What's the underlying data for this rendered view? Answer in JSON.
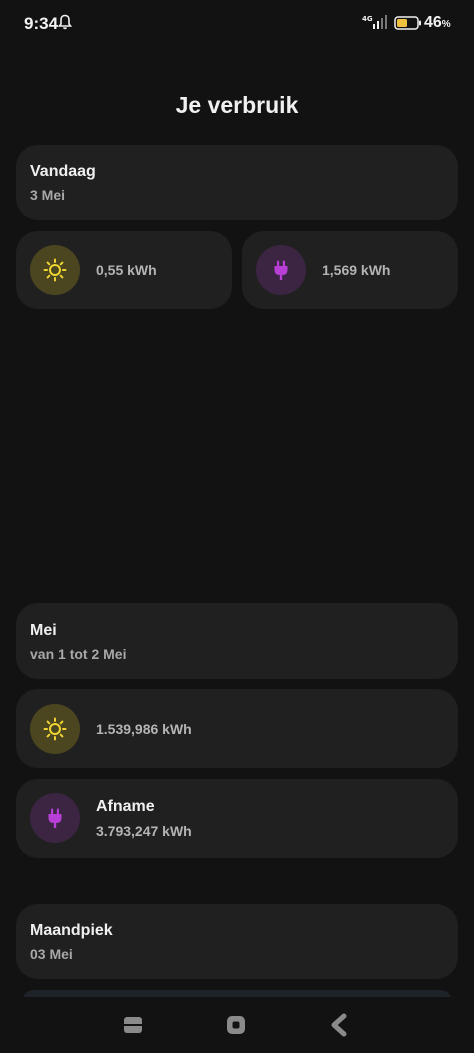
{
  "status": {
    "time": "9:34",
    "network": "4G",
    "battery": "46",
    "battery_unit": "%"
  },
  "page": {
    "title": "Je verbruik"
  },
  "today": {
    "title": "Vandaag",
    "date": "3 Mei",
    "solar_value": "0,55 kWh",
    "grid_value": "1,569 kWh"
  },
  "month": {
    "title": "Mei",
    "range": "van 1 tot 2 Mei",
    "solar_value": "1.539,986 kWh",
    "grid_label": "Afname",
    "grid_value": "3.793,247 kWh"
  },
  "peak": {
    "title": "Maandpiek",
    "date": "03 Mei"
  },
  "icons": {
    "sun": "sun-icon",
    "plug": "plug-icon",
    "nav_recent": "recent-apps-icon",
    "nav_home": "home-icon",
    "nav_back": "back-icon"
  },
  "colors": {
    "background": "#121212",
    "card": "#202020",
    "sun_accent": "#f0d530",
    "plug_accent": "#b83fd6"
  }
}
